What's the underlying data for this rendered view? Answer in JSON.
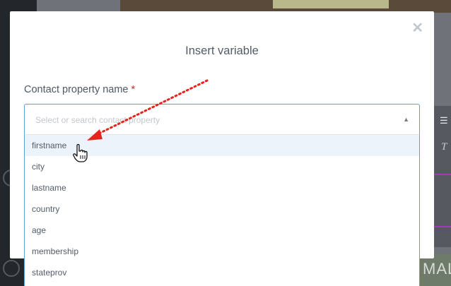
{
  "modal": {
    "title": "Insert variable",
    "close_icon": "close-icon",
    "field_label": "Contact property name",
    "required_mark": "*",
    "select": {
      "placeholder": "Select or search contact property",
      "caret_icon": "caret-up-icon",
      "options": [
        "firstname",
        "city",
        "lastname",
        "country",
        "age",
        "membership",
        "stateprov"
      ],
      "highlighted": "firstname"
    }
  },
  "background": {
    "banner_text": "MAL"
  },
  "colors": {
    "accent_border": "#57a5c8",
    "required": "#e3242b",
    "highlight_row": "#edf3fa",
    "annotation_arrow": "#e8231b"
  }
}
